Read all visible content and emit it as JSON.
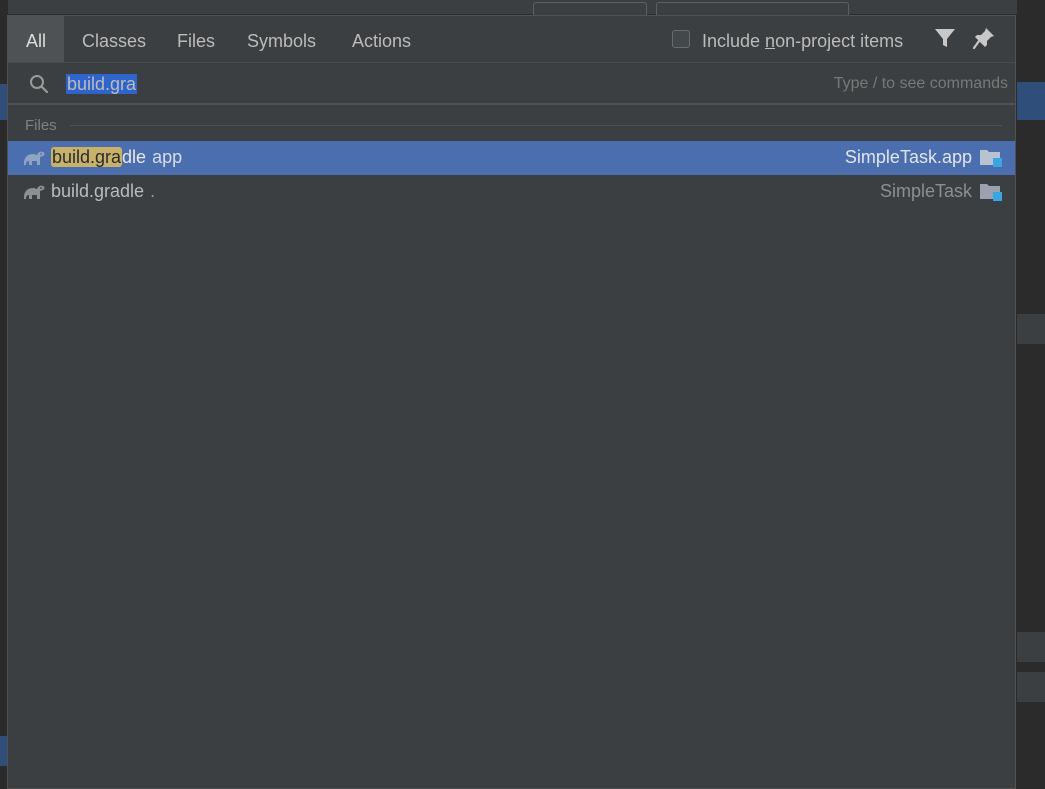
{
  "tabs": [
    {
      "label": "All",
      "active": true
    },
    {
      "label": "Classes",
      "active": false
    },
    {
      "label": "Files",
      "active": false
    },
    {
      "label": "Symbols",
      "active": false
    },
    {
      "label": "Actions",
      "active": false
    }
  ],
  "options": {
    "include_prefix": "Include ",
    "include_mnemonic": "n",
    "include_suffix": "on-project items",
    "include_checked": false
  },
  "icons": {
    "filter": "filter-icon",
    "pin": "pin-icon",
    "search": "search-icon",
    "gradle": "gradle-elephant-icon",
    "module": "module-folder-icon"
  },
  "search": {
    "value": "build.gra",
    "hint": "Type / to see commands"
  },
  "group": {
    "label": "Files"
  },
  "results": [
    {
      "match": "build.gra",
      "rest": "dle",
      "path": "app",
      "location": "SimpleTask.app",
      "selected": true
    },
    {
      "match": "",
      "rest": "build.gradle",
      "path": ".",
      "location": "SimpleTask",
      "selected": false
    }
  ],
  "colors": {
    "popup_bg": "#3c3f41",
    "selection": "#4b6eaf",
    "match_highlight": "#c8b26b",
    "text_selection": "#2f65ca"
  }
}
